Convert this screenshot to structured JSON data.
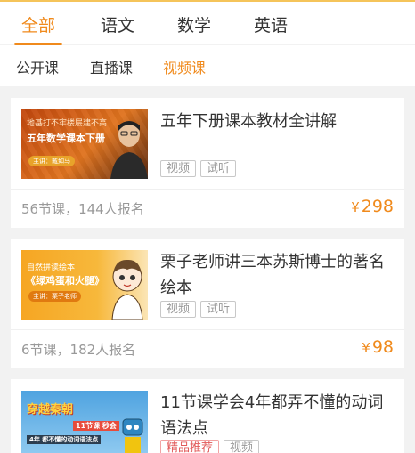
{
  "tabs": [
    {
      "label": "全部",
      "active": true
    },
    {
      "label": "语文",
      "active": false
    },
    {
      "label": "数学",
      "active": false
    },
    {
      "label": "英语",
      "active": false
    }
  ],
  "subtabs": [
    {
      "label": "公开课",
      "active": false
    },
    {
      "label": "直播课",
      "active": false
    },
    {
      "label": "视频课",
      "active": true
    }
  ],
  "courses": [
    {
      "title": "五年下册课本教材全讲解",
      "tags": [
        "视频",
        "试听"
      ],
      "meta": "56节课，144人报名",
      "currency": "¥",
      "price": "298",
      "thumb": {
        "line1": "地基打不牢楼层建不高",
        "line2": "五年数学课本下册",
        "teacher": "主讲：戴如马"
      }
    },
    {
      "title": "栗子老师讲三本苏斯博士的著名绘本",
      "tags": [
        "视频",
        "试听"
      ],
      "meta": "6节课，182人报名",
      "currency": "¥",
      "price": "98",
      "thumb": {
        "line1": "自然拼读绘本",
        "line2": "《绿鸡蛋和火腿》",
        "teacher": "主讲：栗子老师"
      }
    },
    {
      "title": "11节课学会4年都弄不懂的动词语法点",
      "tags": [
        "精品推荐",
        "视频"
      ],
      "thumb": {
        "line1": "穿越秦朝",
        "line2": "11节课 秒会",
        "line3": "4年 都不懂的动词语法点"
      }
    }
  ],
  "colors": {
    "accent": "#f08a1c",
    "hot_tag": "#e25a5a"
  }
}
